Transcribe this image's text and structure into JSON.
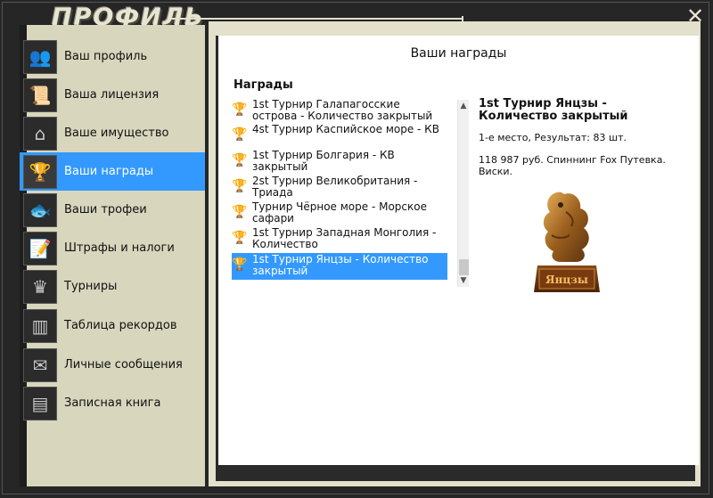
{
  "window": {
    "title": "ПРОФИЛЬ",
    "close_glyph": "✕"
  },
  "sidebar": {
    "items": [
      {
        "label": "Ваш профиль",
        "icon": "users-icon",
        "glyph": "👥",
        "active": false
      },
      {
        "label": "Ваша лицензия",
        "icon": "license-icon",
        "glyph": "📜",
        "active": false
      },
      {
        "label": "Ваше имущество",
        "icon": "house-icon",
        "glyph": "⌂",
        "active": false
      },
      {
        "label": "Ваши награды",
        "icon": "cup-icon",
        "glyph": "🏆",
        "active": true
      },
      {
        "label": "Ваши трофеи",
        "icon": "fish-icon",
        "glyph": "🐟",
        "active": false
      },
      {
        "label": "Штрафы и налоги",
        "icon": "document-icon",
        "glyph": "📝",
        "active": false
      },
      {
        "label": "Турниры",
        "icon": "tournament-icon",
        "glyph": "♛",
        "active": false
      },
      {
        "label": "Таблица рекордов",
        "icon": "chart-icon",
        "glyph": "▥",
        "active": false
      },
      {
        "label": "Личные сообщения",
        "icon": "envelope-icon",
        "glyph": "✉",
        "active": false
      },
      {
        "label": "Записная книга",
        "icon": "notebook-icon",
        "glyph": "▤",
        "active": false
      }
    ]
  },
  "main": {
    "title": "Ваши награды",
    "section_label": "Награды",
    "awards": [
      {
        "label": "1st Турнир Галапагосские острова - Количество закрытый",
        "selected": false,
        "glyph": "🏆"
      },
      {
        "label": "4st Турнир Каспийское море - КВ",
        "selected": false,
        "glyph": "🏆"
      },
      {
        "label": "1st Турнир Болгария - КВ закрытый",
        "selected": false,
        "glyph": "🏆"
      },
      {
        "label": "2st Турнир Великобритания - Триада",
        "selected": false,
        "glyph": "🏆"
      },
      {
        "label": "Турнир Чёрное море - Морское сафари",
        "selected": false,
        "glyph": "🏆"
      },
      {
        "label": "1st Турнир Западная Монголия - Количество",
        "selected": false,
        "glyph": "🏆"
      },
      {
        "label": "1st Турнир Янцзы - Количество закрытый",
        "selected": true,
        "glyph": "🏆"
      }
    ],
    "scroll_up": "▲",
    "scroll_down": "▼",
    "detail": {
      "title": "1st Турнир Янцзы - Количество закрытый",
      "place": "1-е место, Результат: 83 шт.",
      "prize": "118 987 руб. Спиннинг Fox Путевка. Виски.",
      "trophy_plate_text": "Янцзы"
    }
  },
  "colors": {
    "accent": "#3399ff",
    "frame": "#262626",
    "panel_bg": "#d8d6bd"
  }
}
